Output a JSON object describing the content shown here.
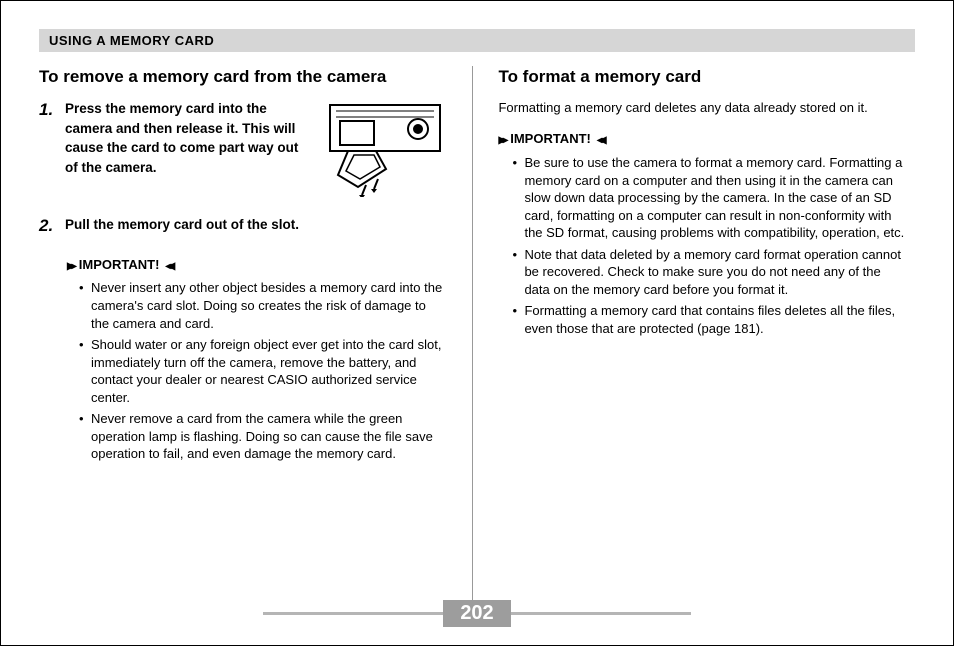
{
  "header": {
    "sectionTitle": "USING A MEMORY CARD"
  },
  "left": {
    "title": "To remove a memory card from the camera",
    "steps": [
      {
        "num": "1.",
        "text": "Press the memory card into the camera and then release it. This will cause the card to come part way out of the camera."
      },
      {
        "num": "2.",
        "text": "Pull the memory card out of the slot."
      }
    ],
    "importantLabel": "IMPORTANT!",
    "notes": [
      "Never insert any other object besides a memory card into the camera's card slot. Doing so creates the risk of damage to the camera and card.",
      "Should water or any foreign object ever get into the card slot, immediately turn off the camera, remove the battery, and contact your dealer or nearest CASIO authorized service center.",
      "Never remove a card from the camera while the green operation lamp is flashing. Doing so can cause the file save operation to fail, and even damage the memory card."
    ]
  },
  "right": {
    "title": "To format a memory card",
    "intro": "Formatting a memory card deletes any data already stored on it.",
    "importantLabel": "IMPORTANT!",
    "notes": [
      "Be sure to use the camera to format a memory card. Formatting a memory card on a computer and then using it in the camera can slow down data processing by the camera. In the case of an SD card, formatting on a computer can result in non-conformity with the SD format, causing problems with compatibility, operation, etc.",
      "Note that data deleted by a memory card format operation cannot be recovered. Check to make sure you do not need any of the data on the memory card before you format it.",
      "Formatting a memory card that contains files deletes all the files, even those that are protected (page 181)."
    ]
  },
  "footer": {
    "pageNumber": "202"
  }
}
